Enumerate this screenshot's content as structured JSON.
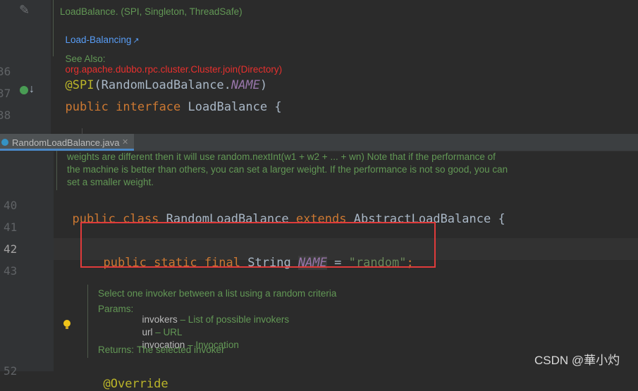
{
  "top_editor": {
    "doc": {
      "line1": "LoadBalance. (SPI, Singleton, ThreadSafe)",
      "link": "Load-Balancing",
      "link_arrow": "↗",
      "see_also_label": "See Also:",
      "see_also_value": "org.apache.dubbo.rpc.cluster.Cluster.join(Directory)"
    },
    "line_numbers": [
      "36",
      "37",
      "38"
    ],
    "code": {
      "l1_ann": "@SPI",
      "l1_open": "(RandomLoadBalance.",
      "l1_field": "NAME",
      "l1_close": ")",
      "l2_kw1": "public",
      "l2_kw2": "interface",
      "l2_name": "LoadBalance {"
    }
  },
  "tab": {
    "label": "RandomLoadBalance.java",
    "close": "✕"
  },
  "bottom_editor": {
    "doc_lines": [
      "weights are different then it will use random.nextInt(w1 + w2 + ... + wn) Note that if the performance of",
      "the machine is better than others, you can set a larger weight. If the performance is not so good, you can",
      "set a smaller weight."
    ],
    "line_numbers": [
      "40",
      "41",
      "42",
      "43",
      "52"
    ],
    "code": {
      "l40_kw1": "public",
      "l40_kw2": "class",
      "l40_name": "RandomLoadBalance",
      "l40_kw3": "extends",
      "l40_parent": "AbstractLoadBalance {",
      "l42_kw1": "public",
      "l42_kw2": "static",
      "l42_kw3": "final",
      "l42_type": "String",
      "l42_field": "NAME",
      "l42_eq": " = ",
      "l42_str": "\"random\"",
      "l42_semi": ";",
      "l52_partial": "@Override"
    },
    "method_doc": {
      "summary": "Select one invoker between a list using a random criteria",
      "params_label": "Params:",
      "p1_name": "invokers",
      "p1_desc": " – List of possible invokers",
      "p2_name": "url",
      "p2_desc": " – URL",
      "p3_name": "invocation",
      "p3_desc": " – Invocation",
      "returns_label": "Returns:",
      "returns_desc": "The selected invoker"
    }
  },
  "watermark": "CSDN @華小灼",
  "colors": {
    "highlight_box": "#e03b3b",
    "keyword": "#cc7832",
    "doc_green": "#629755",
    "link_blue": "#589df6"
  }
}
